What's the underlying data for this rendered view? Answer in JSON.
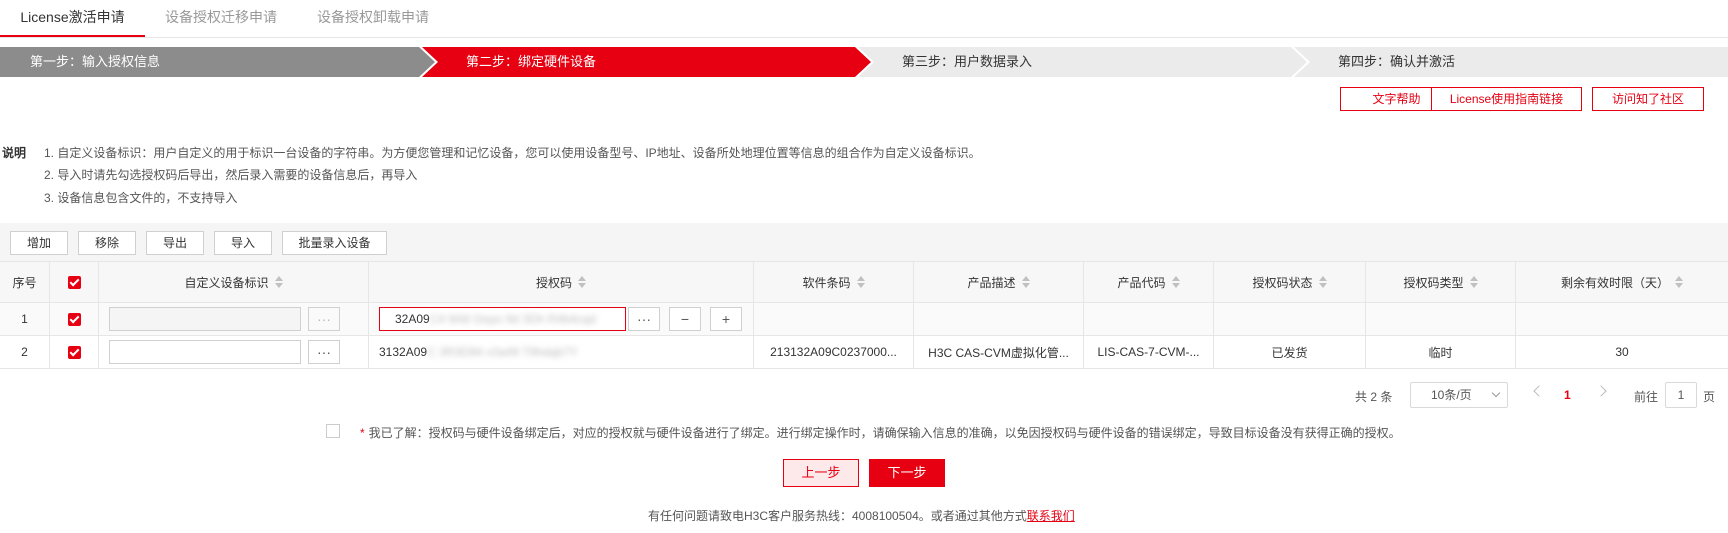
{
  "tabs": [
    {
      "label": "License激活申请",
      "active": true
    },
    {
      "label": "设备授权迁移申请",
      "active": false
    },
    {
      "label": "设备授权卸载申请",
      "active": false
    }
  ],
  "steps": [
    {
      "label": "第一步：输入授权信息"
    },
    {
      "label": "第二步：绑定硬件设备"
    },
    {
      "label": "第三步：用户数据录入"
    },
    {
      "label": "第四步：确认并激活"
    }
  ],
  "help_links": {
    "text_help": "文字帮助",
    "guide": "License使用指南链接",
    "community": "访问知了社区"
  },
  "notes": {
    "label": "说明",
    "items": [
      "1. 自定义设备标识：用户自定义的用于标识一台设备的字符串。为方便您管理和记忆设备，您可以使用设备型号、IP地址、设备所处地理位置等信息的组合作为自定义设备标识。",
      "2. 导入时请先勾选授权码后导出，然后录入需要的设备信息后，再导入",
      "3. 设备信息包含文件的，不支持导入"
    ]
  },
  "toolbar": {
    "add": "增加",
    "remove": "移除",
    "export": "导出",
    "import": "导入",
    "batch": "批量录入设备"
  },
  "table": {
    "headers": {
      "index": "序号",
      "device_id": "自定义设备标识",
      "auth_code": "授权码",
      "software_code": "软件条码",
      "product_desc": "产品描述",
      "product_code": "产品代码",
      "status": "授权码状态",
      "type": "授权码类型",
      "remaining": "剩余有效时限（天）"
    },
    "rows": [
      {
        "index": "1",
        "auth_prefix": "32A09",
        "auth_masked": "C4 9A8 Gepo 9d 3Dh R4b4cqd",
        "software_code": "",
        "product_desc": "",
        "product_code": "",
        "status": "",
        "type": "",
        "remaining": ""
      },
      {
        "index": "2",
        "auth_prefix": "3132A09",
        "auth_masked": "C 3R3D94 x3a49 T9hdqb7Y",
        "software_code": "213132A09C0237000...",
        "product_desc": "H3C CAS-CVM虚拟化管...",
        "product_code": "LIS-CAS-7-CVM-...",
        "status": "已发货",
        "type": "临时",
        "remaining": "30"
      }
    ],
    "more_glyph": "···",
    "minus_glyph": "−",
    "plus_glyph": "+"
  },
  "pagination": {
    "total": "共 2 条",
    "page_size": "10条/页",
    "current_page": "1",
    "goto_label": "前往",
    "goto_value": "1",
    "page_suffix": "页"
  },
  "agreement": {
    "star": "*",
    "text": "我已了解：授权码与硬件设备绑定后，对应的授权就与硬件设备进行了绑定。进行绑定操作时，请确保输入信息的准确，以免因授权码与硬件设备的错误绑定，导致目标设备没有获得正确的授权。"
  },
  "buttons": {
    "prev": "上一步",
    "next": "下一步"
  },
  "footer": {
    "text": "有任何问题请致电H3C客户服务热线：4008100504。或者通过其他方式",
    "link": "联系我们"
  },
  "colors": {
    "accent": "#e60012",
    "step_done": "#8c8c8c",
    "step_pending": "#ebebeb"
  }
}
